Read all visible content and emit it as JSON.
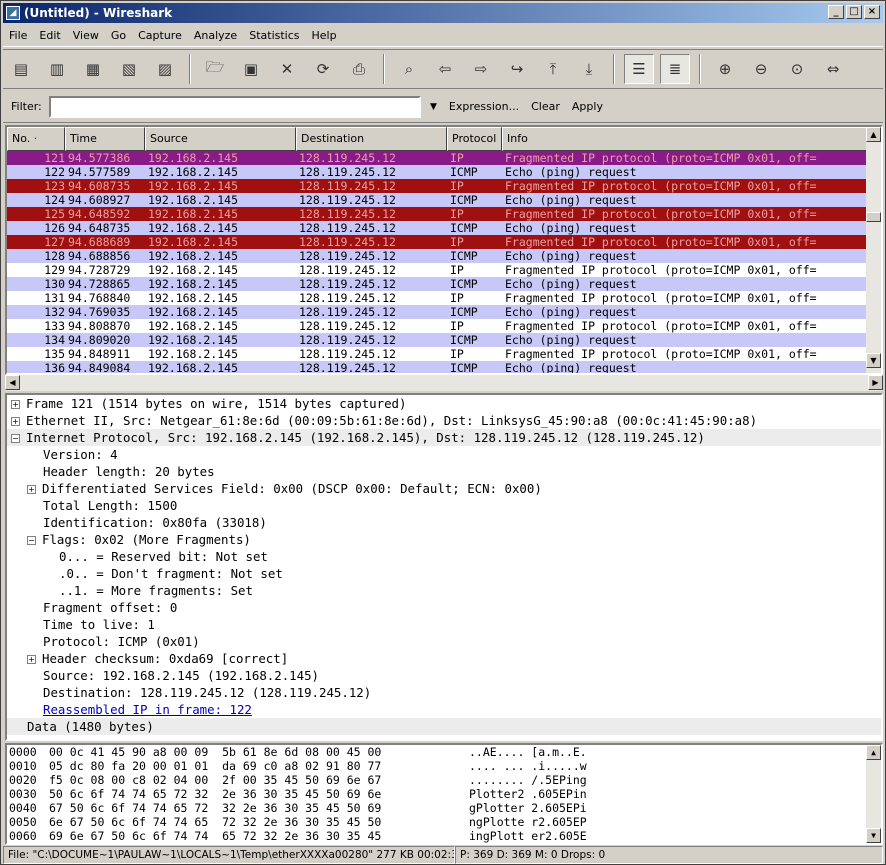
{
  "window": {
    "title": "(Untitled) - Wireshark",
    "app_icon": "wireshark-fin-icon"
  },
  "menu": [
    "File",
    "Edit",
    "View",
    "Go",
    "Capture",
    "Analyze",
    "Statistics",
    "Help"
  ],
  "toolbar_icons": [
    "interface-list-icon",
    "capture-options-icon",
    "start-capture-icon",
    "stop-capture-icon",
    "restart-capture-icon",
    "open-file-icon",
    "save-file-icon",
    "close-file-icon",
    "reload-icon",
    "print-icon",
    "find-packet-icon",
    "go-back-icon",
    "go-forward-icon",
    "go-to-packet-icon",
    "go-first-icon",
    "go-last-icon",
    "colorize-icon",
    "auto-scroll-icon",
    "zoom-in-icon",
    "zoom-out-icon",
    "normal-size-icon",
    "resize-columns-icon"
  ],
  "filter": {
    "label": "Filter:",
    "value": "",
    "expression": "Expression...",
    "clear": "Clear",
    "apply": "Apply"
  },
  "columns": [
    "No. ·",
    "Time",
    "Source",
    "Destination",
    "Protocol",
    "Info"
  ],
  "colors": {
    "selected_bg": "#8b1a89",
    "fragment_bg": "#a01010",
    "icmp_bg": "#c8c8f8",
    "fragment_fg": "#e8a0a0",
    "normal_fg": "#000000"
  },
  "packets": [
    {
      "no": "121",
      "time": "94.577386",
      "src": "192.168.2.145",
      "dst": "128.119.245.12",
      "proto": "IP",
      "info": "Fragmented IP protocol (proto=ICMP 0x01, off=",
      "style": "selected"
    },
    {
      "no": "122",
      "time": "94.577589",
      "src": "192.168.2.145",
      "dst": "128.119.245.12",
      "proto": "ICMP",
      "info": "Echo (ping) request",
      "style": "icmp"
    },
    {
      "no": "123",
      "time": "94.608735",
      "src": "192.168.2.145",
      "dst": "128.119.245.12",
      "proto": "IP",
      "info": "Fragmented IP protocol (proto=ICMP 0x01, off=",
      "style": "frag"
    },
    {
      "no": "124",
      "time": "94.608927",
      "src": "192.168.2.145",
      "dst": "128.119.245.12",
      "proto": "ICMP",
      "info": "Echo (ping) request",
      "style": "icmp"
    },
    {
      "no": "125",
      "time": "94.648592",
      "src": "192.168.2.145",
      "dst": "128.119.245.12",
      "proto": "IP",
      "info": "Fragmented IP protocol (proto=ICMP 0x01, off=",
      "style": "frag"
    },
    {
      "no": "126",
      "time": "94.648735",
      "src": "192.168.2.145",
      "dst": "128.119.245.12",
      "proto": "ICMP",
      "info": "Echo (ping) request",
      "style": "icmp"
    },
    {
      "no": "127",
      "time": "94.688689",
      "src": "192.168.2.145",
      "dst": "128.119.245.12",
      "proto": "IP",
      "info": "Fragmented IP protocol (proto=ICMP 0x01, off=",
      "style": "frag"
    },
    {
      "no": "128",
      "time": "94.688856",
      "src": "192.168.2.145",
      "dst": "128.119.245.12",
      "proto": "ICMP",
      "info": "Echo (ping) request",
      "style": "icmp"
    },
    {
      "no": "129",
      "time": "94.728729",
      "src": "192.168.2.145",
      "dst": "128.119.245.12",
      "proto": "IP",
      "info": "Fragmented IP protocol (proto=ICMP 0x01, off=",
      "style": "plain"
    },
    {
      "no": "130",
      "time": "94.728865",
      "src": "192.168.2.145",
      "dst": "128.119.245.12",
      "proto": "ICMP",
      "info": "Echo (ping) request",
      "style": "icmp"
    },
    {
      "no": "131",
      "time": "94.768840",
      "src": "192.168.2.145",
      "dst": "128.119.245.12",
      "proto": "IP",
      "info": "Fragmented IP protocol (proto=ICMP 0x01, off=",
      "style": "plain"
    },
    {
      "no": "132",
      "time": "94.769035",
      "src": "192.168.2.145",
      "dst": "128.119.245.12",
      "proto": "ICMP",
      "info": "Echo (ping) request",
      "style": "icmp"
    },
    {
      "no": "133",
      "time": "94.808870",
      "src": "192.168.2.145",
      "dst": "128.119.245.12",
      "proto": "IP",
      "info": "Fragmented IP protocol (proto=ICMP 0x01, off=",
      "style": "plain"
    },
    {
      "no": "134",
      "time": "94.809020",
      "src": "192.168.2.145",
      "dst": "128.119.245.12",
      "proto": "ICMP",
      "info": "Echo (ping) request",
      "style": "icmp"
    },
    {
      "no": "135",
      "time": "94.848911",
      "src": "192.168.2.145",
      "dst": "128.119.245.12",
      "proto": "IP",
      "info": "Fragmented IP protocol (proto=ICMP 0x01, off=",
      "style": "plain"
    },
    {
      "no": "136",
      "time": "94.849084",
      "src": "192.168.2.145",
      "dst": "128.119.245.12",
      "proto": "ICMP",
      "info": "Echo (ping) request",
      "style": "icmp"
    }
  ],
  "details": [
    {
      "indent": 0,
      "exp": "+",
      "text": "Frame 121 (1514 bytes on wire, 1514 bytes captured)"
    },
    {
      "indent": 0,
      "exp": "+",
      "text": "Ethernet II, Src: Netgear_61:8e:6d (00:09:5b:61:8e:6d), Dst: LinksysG_45:90:a8 (00:0c:41:45:90:a8)"
    },
    {
      "indent": 0,
      "exp": "-",
      "text": "Internet Protocol, Src: 192.168.2.145 (192.168.2.145), Dst: 128.119.245.12 (128.119.245.12)",
      "hl": true
    },
    {
      "indent": 1,
      "exp": "",
      "text": "Version: 4"
    },
    {
      "indent": 1,
      "exp": "",
      "text": "Header length: 20 bytes"
    },
    {
      "indent": 1,
      "exp": "+",
      "text": "Differentiated Services Field: 0x00 (DSCP 0x00: Default; ECN: 0x00)"
    },
    {
      "indent": 1,
      "exp": "",
      "text": "Total Length: 1500"
    },
    {
      "indent": 1,
      "exp": "",
      "text": "Identification: 0x80fa (33018)"
    },
    {
      "indent": 1,
      "exp": "-",
      "text": "Flags: 0x02 (More Fragments)"
    },
    {
      "indent": 2,
      "exp": "",
      "text": "0... = Reserved bit: Not set"
    },
    {
      "indent": 2,
      "exp": "",
      "text": ".0.. = Don't fragment: Not set"
    },
    {
      "indent": 2,
      "exp": "",
      "text": "..1. = More fragments: Set"
    },
    {
      "indent": 1,
      "exp": "",
      "text": "Fragment offset: 0"
    },
    {
      "indent": 1,
      "exp": "",
      "text": "Time to live: 1"
    },
    {
      "indent": 1,
      "exp": "",
      "text": "Protocol: ICMP (0x01)"
    },
    {
      "indent": 1,
      "exp": "+",
      "text": "Header checksum: 0xda69 [correct]"
    },
    {
      "indent": 1,
      "exp": "",
      "text": "Source: 192.168.2.145 (192.168.2.145)"
    },
    {
      "indent": 1,
      "exp": "",
      "text": "Destination: 128.119.245.12 (128.119.245.12)"
    },
    {
      "indent": 1,
      "exp": "",
      "text": "Reassembled IP in frame: 122",
      "link": true
    },
    {
      "indent": 0,
      "exp": "",
      "text": "Data (1480 bytes)",
      "hl": true
    }
  ],
  "hex": [
    {
      "off": "0000",
      "bytes": "00 0c 41 45 90 a8 00 09  5b 61 8e 6d 08 00 45 00",
      "ascii": "..AE.... [a.m..E."
    },
    {
      "off": "0010",
      "bytes": "05 dc 80 fa 20 00 01 01  da 69 c0 a8 02 91 80 77",
      "ascii": ".... ... .i.....w"
    },
    {
      "off": "0020",
      "bytes": "f5 0c 08 00 c8 02 04 00  2f 00 35 45 50 69 6e 67",
      "ascii": "........ /.5EPing"
    },
    {
      "off": "0030",
      "bytes": "50 6c 6f 74 74 65 72 32  2e 36 30 35 45 50 69 6e",
      "ascii": "Plotter2 .605EPin"
    },
    {
      "off": "0040",
      "bytes": "67 50 6c 6f 74 74 65 72  32 2e 36 30 35 45 50 69",
      "ascii": "gPlotter 2.605EPi"
    },
    {
      "off": "0050",
      "bytes": "6e 67 50 6c 6f 74 74 65  72 32 2e 36 30 35 45 50",
      "ascii": "ngPlotte r2.605EP"
    },
    {
      "off": "0060",
      "bytes": "69 6e 67 50 6c 6f 74 74  65 72 32 2e 36 30 35 45",
      "ascii": "ingPlott er2.605E"
    }
  ],
  "status": {
    "file": "File: \"C:\\DOCUME~1\\PAULAW~1\\LOCALS~1\\Temp\\etherXXXXa00280\" 277 KB 00:02:32",
    "counts": "P: 369 D: 369 M: 0 Drops: 0"
  }
}
